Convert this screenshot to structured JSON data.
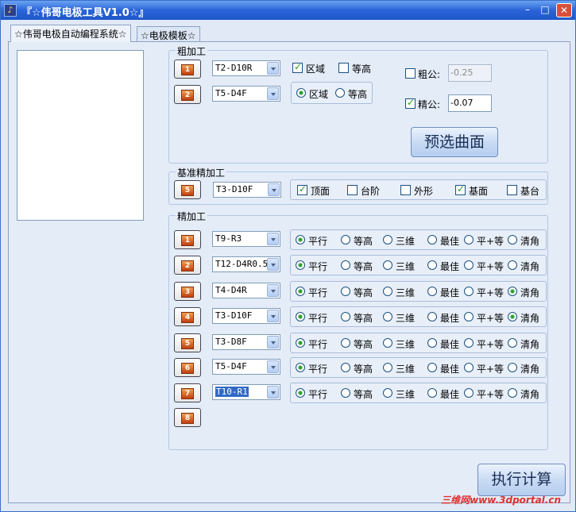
{
  "window": {
    "title": "『☆伟哥电极工具V1.0☆』",
    "minimize": "–",
    "maximize": "□",
    "close": "✕"
  },
  "tabs": [
    {
      "label": "☆伟哥电极自动编程系统☆"
    },
    {
      "label": "☆电极模板☆"
    }
  ],
  "rough": {
    "title": "粗加工",
    "rows": [
      {
        "num": "1",
        "tool": "T2-D10R"
      },
      {
        "num": "2",
        "tool": "T5-D4F"
      }
    ],
    "row1_options": [
      {
        "label": "区域",
        "checked": true
      },
      {
        "label": "等高",
        "checked": false
      }
    ],
    "row2_options": [
      {
        "label": "区域",
        "checked": true
      },
      {
        "label": "等高",
        "checked": false
      }
    ],
    "cu_gong": {
      "label": "粗公:",
      "checked": false,
      "value": "-0.25"
    },
    "jing_gong": {
      "label": "精公:",
      "checked": true,
      "value": "-0.07"
    },
    "preselect_button": "预选曲面"
  },
  "datum": {
    "title": "基准精加工",
    "num": "5",
    "tool": "T3-D10F",
    "options": [
      {
        "label": "顶面",
        "checked": true
      },
      {
        "label": "台阶",
        "checked": false
      },
      {
        "label": "外形",
        "checked": false
      },
      {
        "label": "基面",
        "checked": true
      },
      {
        "label": "基台",
        "checked": false
      }
    ]
  },
  "finish": {
    "title": "精加工",
    "radio_labels": [
      "平行",
      "等高",
      "三维",
      "最佳",
      "平+等",
      "清角"
    ],
    "rows": [
      {
        "num": "1",
        "tool": "T9-R3",
        "selected": [
          "平行"
        ]
      },
      {
        "num": "2",
        "tool": "T12-D4R0.5",
        "selected": [
          "平行"
        ]
      },
      {
        "num": "3",
        "tool": "T4-D4R",
        "selected": [
          "平行",
          "清角"
        ]
      },
      {
        "num": "4",
        "tool": "T3-D10F",
        "selected": [
          "平行",
          "清角"
        ]
      },
      {
        "num": "5",
        "tool": "T3-D8F",
        "selected": [
          "平行"
        ]
      },
      {
        "num": "6",
        "tool": "T5-D4F",
        "selected": [
          "平行"
        ]
      },
      {
        "num": "7",
        "tool": "T10-R1",
        "selected": [
          "平行"
        ],
        "tool_highlighted": true
      },
      {
        "num": "8"
      }
    ]
  },
  "execute_button": "执行计算",
  "watermark": "三维网www.3dportal.cn",
  "colors": {
    "titlebar": "#2a64d8",
    "checkmark": "#21a121",
    "radio_dot": "#2f9b2f",
    "watermark": "#e03030",
    "num_icon": "#c04010"
  }
}
